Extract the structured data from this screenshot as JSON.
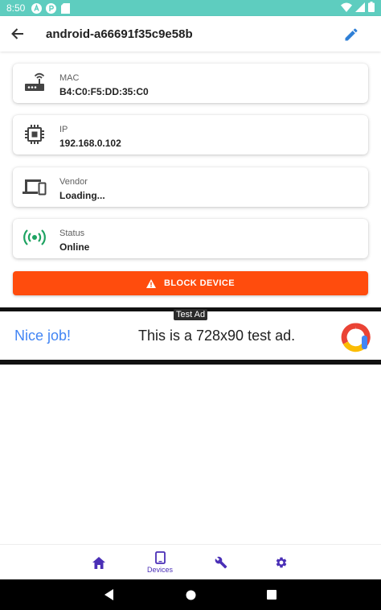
{
  "status_bar": {
    "time": "8:50",
    "notification_icons": [
      "a-circle-icon",
      "p-circle-icon",
      "sd-card-icon"
    ]
  },
  "app_bar": {
    "title": "android-a66691f35c9e58b"
  },
  "cards": [
    {
      "icon": "router-icon",
      "label": "MAC",
      "value": "B4:C0:F5:DD:35:C0"
    },
    {
      "icon": "chip-icon",
      "label": "IP",
      "value": "192.168.0.102"
    },
    {
      "icon": "devices-icon",
      "label": "Vendor",
      "value": "Loading..."
    },
    {
      "icon": "broadcast-icon",
      "label": "Status",
      "value": "Online"
    }
  ],
  "block_button": {
    "label": "BLOCK DEVICE"
  },
  "ad": {
    "badge": "Test Ad",
    "headline": "Nice job!",
    "text": "This is a 728x90 test ad."
  },
  "bottom_nav": [
    {
      "name": "home",
      "label": ""
    },
    {
      "name": "devices",
      "label": "Devices",
      "active": true
    },
    {
      "name": "tools",
      "label": ""
    },
    {
      "name": "settings",
      "label": ""
    }
  ],
  "colors": {
    "status_bar": "#5ecdbf",
    "accent": "#4a2fb6",
    "edit_icon": "#2e7fd6",
    "block_button": "#ff4c0d",
    "online": "#1ea362",
    "ad_blue": "#4285f4"
  }
}
